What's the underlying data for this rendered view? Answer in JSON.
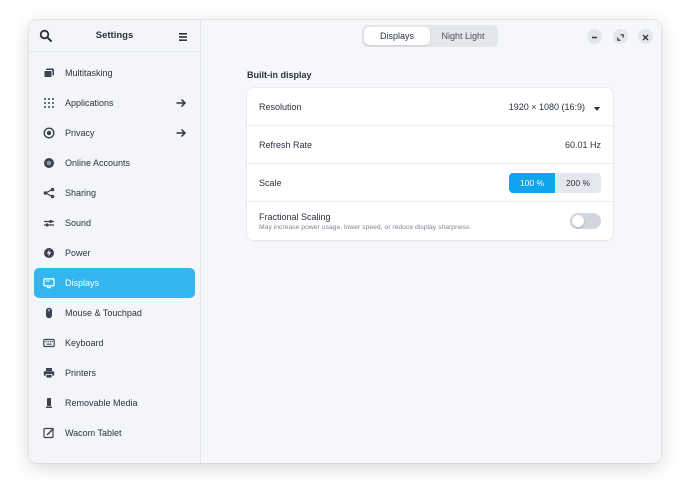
{
  "sidebar": {
    "title": "Settings",
    "items": [
      {
        "label": "Multitasking",
        "icon": "multitasking-icon"
      },
      {
        "label": "Applications",
        "icon": "applications-icon",
        "has_arrow": true
      },
      {
        "label": "Privacy",
        "icon": "privacy-icon",
        "has_arrow": true
      },
      {
        "label": "Online Accounts",
        "icon": "online-accounts-icon"
      },
      {
        "label": "Sharing",
        "icon": "sharing-icon"
      },
      {
        "label": "Sound",
        "icon": "sound-icon"
      },
      {
        "label": "Power",
        "icon": "power-icon"
      },
      {
        "label": "Displays",
        "icon": "displays-icon",
        "active": true
      },
      {
        "label": "Mouse & Touchpad",
        "icon": "mouse-icon"
      },
      {
        "label": "Keyboard",
        "icon": "keyboard-icon"
      },
      {
        "label": "Printers",
        "icon": "printer-icon"
      },
      {
        "label": "Removable Media",
        "icon": "removable-media-icon"
      },
      {
        "label": "Wacom Tablet",
        "icon": "wacom-tablet-icon"
      }
    ]
  },
  "header": {
    "tabs": [
      {
        "label": "Displays",
        "active": true
      },
      {
        "label": "Night Light",
        "active": false
      }
    ]
  },
  "content": {
    "section_title": "Built-in display",
    "resolution": {
      "label": "Resolution",
      "value": "1920 × 1080 (16:9)"
    },
    "refresh_rate": {
      "label": "Refresh Rate",
      "value": "60.01 Hz"
    },
    "scale": {
      "label": "Scale",
      "options": [
        "100 %",
        "200 %"
      ],
      "selected": "100 %"
    },
    "fractional_scaling": {
      "label": "Fractional Scaling",
      "description": "May increase power usage, lower speed, or reduce display sharpness.",
      "enabled": false
    }
  },
  "colors": {
    "accent": "#31b6f0",
    "accent_button": "#0fa4eb",
    "window_bg": "#f6f7fa",
    "sidebar_bg": "#f3f5f8"
  }
}
